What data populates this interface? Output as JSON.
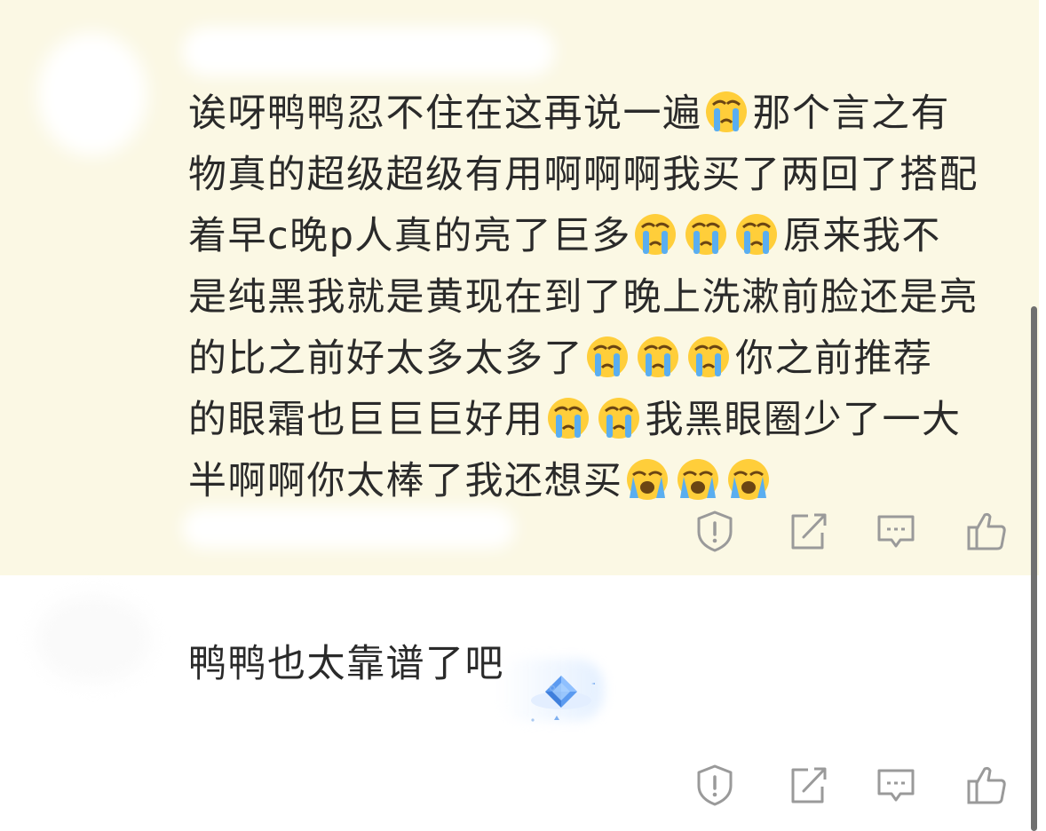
{
  "comments": [
    {
      "text_lines": [
        "诶呀鸭鸭忍不住在这再说一遍",
        "那个言之有",
        "物真的超级超级有用啊啊啊我买了两回了搭配",
        "着早c晚p人真的亮了巨多",
        "原来我不",
        "是纯黑我就是黄现在到了晚上洗漱前脸还是亮",
        "的比之前好太多太多了",
        "你之前推荐",
        "的眼霜也巨巨巨好用",
        "我黑眼圈少了一大",
        "半啊啊你太棒了我还想买"
      ],
      "emoji": "crying-face"
    },
    {
      "text": "鸭鸭也太靠谱了吧",
      "badge": "diamond-gem-badge"
    }
  ],
  "actions": [
    {
      "name": "report",
      "icon": "warning-shield-icon"
    },
    {
      "name": "share",
      "icon": "share-icon"
    },
    {
      "name": "reply",
      "icon": "comment-icon"
    },
    {
      "name": "like",
      "icon": "thumbs-up-icon"
    }
  ],
  "colors": {
    "highlight_bg": "#fbf8e4",
    "text": "#2a2a2a",
    "icon": "#9a9a9a",
    "gem": "#4a8ee8"
  }
}
